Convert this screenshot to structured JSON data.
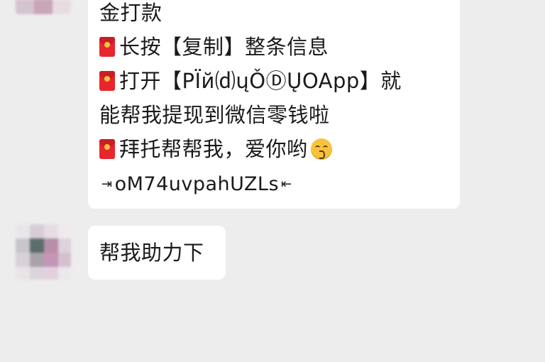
{
  "messages": [
    {
      "lines": [
        {
          "icon": "",
          "text": "金打款"
        },
        {
          "icon": "red-envelope-icon",
          "text": "长按【复制】整条信息"
        },
        {
          "icon": "red-envelope-icon",
          "text": "打开【PÏй⒟ųǑⒹŲOApp】就"
        },
        {
          "icon": "",
          "text": "能帮我提现到微信零钱啦"
        },
        {
          "icon": "red-envelope-icon",
          "text": "拜托帮帮我，爱你哟",
          "trailing_icon": "kissing-face-emoji"
        }
      ],
      "code": {
        "left_arrow": "⇥",
        "text": "oM74uvpahUZLs",
        "right_arrow": "⇤"
      }
    },
    {
      "lines": [
        {
          "icon": "",
          "text": "帮我助力下"
        }
      ]
    }
  ],
  "colors": {
    "background": "#ededed",
    "bubble": "#ffffff",
    "text": "#1a1a1a",
    "red_envelope": "#e8262d"
  }
}
